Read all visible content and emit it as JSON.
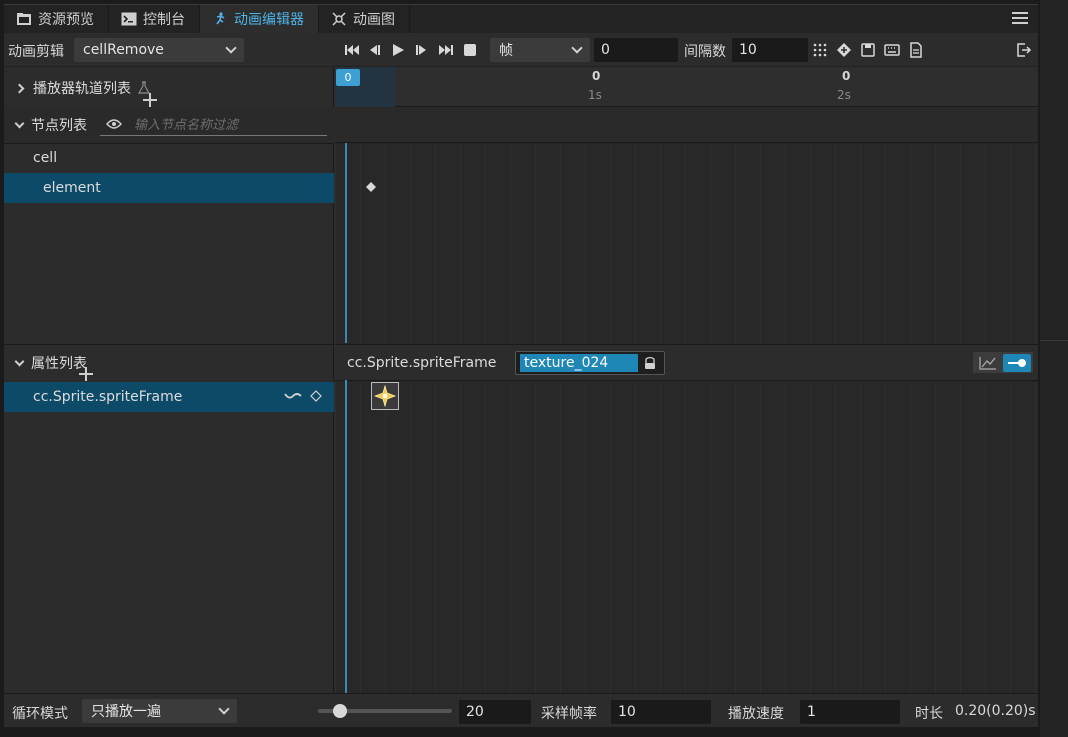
{
  "tabs": [
    {
      "label": "资源预览",
      "icon": "folder-icon",
      "active": false
    },
    {
      "label": "控制台",
      "icon": "terminal-icon",
      "active": false
    },
    {
      "label": "动画编辑器",
      "icon": "running-man-icon",
      "active": true
    },
    {
      "label": "动画图",
      "icon": "animation-graph-icon",
      "active": false
    }
  ],
  "toolbar": {
    "clip_label": "动画剪辑",
    "clip_value": "cellRemove",
    "unit_value": "帧",
    "frame_value": "0",
    "spacing_label": "间隔数",
    "spacing_value": "10"
  },
  "left": {
    "player_tracks_label": "播放器轨道列表",
    "node_list_label": "节点列表",
    "node_filter_placeholder": "输入节点名称过滤",
    "nodes": [
      {
        "label": "cell",
        "selected": false
      },
      {
        "label": "element",
        "selected": true
      }
    ],
    "props_label": "属性列表",
    "props": [
      {
        "label": "cc.Sprite.spriteFrame",
        "selected": true
      }
    ]
  },
  "timeline": {
    "ruler_marks": [
      {
        "frame": "0",
        "sec": ""
      },
      {
        "frame": "0",
        "sec": "1s"
      },
      {
        "frame": "0",
        "sec": "2s"
      }
    ],
    "current_frame_badge": "0",
    "prop_label": "cc.Sprite.spriteFrame",
    "prop_value": "texture_024"
  },
  "footer": {
    "loop_label": "循环模式",
    "loop_value": "只播放一遍",
    "zoom_value": "20",
    "sample_label": "采样帧率",
    "sample_value": "10",
    "speed_label": "播放速度",
    "speed_value": "1",
    "duration_label": "时长",
    "duration_value": "0.20(0.20)s"
  },
  "colors": {
    "accent": "#4fb3e6",
    "selection": "#0d4a68",
    "playhead": "#3a8ab5"
  }
}
